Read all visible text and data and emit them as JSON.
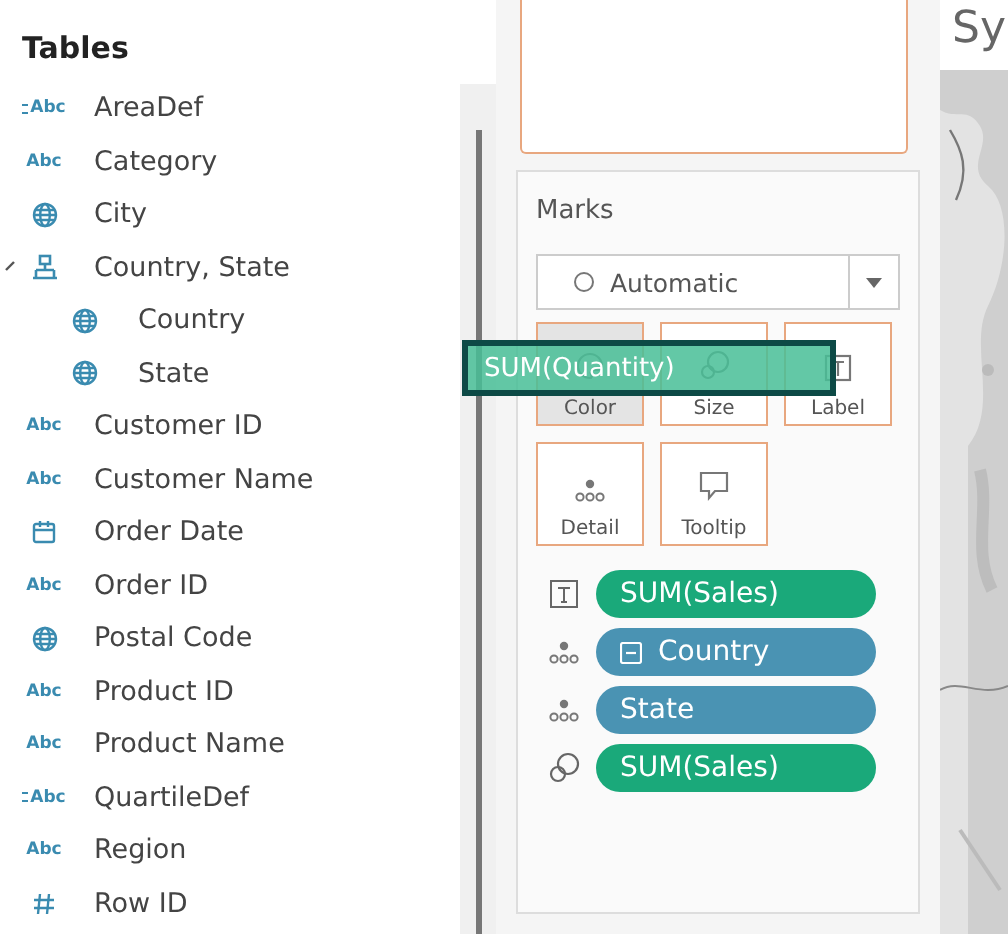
{
  "tables": {
    "title": "Tables",
    "fields": [
      {
        "name": "AreaDef",
        "kind": "calc-text",
        "type_label": "Abc"
      },
      {
        "name": "Category",
        "kind": "text",
        "type_label": "Abc"
      },
      {
        "name": "City",
        "kind": "geo"
      },
      {
        "name": "Country, State",
        "kind": "hierarchy",
        "expanded": true,
        "children": [
          {
            "name": "Country",
            "kind": "geo"
          },
          {
            "name": "State",
            "kind": "geo"
          }
        ]
      },
      {
        "name": "Customer ID",
        "kind": "text",
        "type_label": "Abc"
      },
      {
        "name": "Customer Name",
        "kind": "text",
        "type_label": "Abc"
      },
      {
        "name": "Order Date",
        "kind": "date"
      },
      {
        "name": "Order ID",
        "kind": "text",
        "type_label": "Abc"
      },
      {
        "name": "Postal Code",
        "kind": "geo"
      },
      {
        "name": "Product ID",
        "kind": "text",
        "type_label": "Abc"
      },
      {
        "name": "Product Name",
        "kind": "text",
        "type_label": "Abc"
      },
      {
        "name": "QuartileDef",
        "kind": "calc-text",
        "type_label": "Abc"
      },
      {
        "name": "Region",
        "kind": "text",
        "type_label": "Abc"
      },
      {
        "name": "Row ID",
        "kind": "number"
      }
    ]
  },
  "marks": {
    "title": "Marks",
    "mark_type": "Automatic",
    "buttons": [
      {
        "label": "Color",
        "kind": "color",
        "selected": true
      },
      {
        "label": "Size",
        "kind": "size",
        "selected": false
      },
      {
        "label": "Label",
        "kind": "label",
        "selected": false
      },
      {
        "label": "Detail",
        "kind": "detail",
        "selected": false
      },
      {
        "label": "Tooltip",
        "kind": "tooltip",
        "selected": false
      }
    ],
    "pills": [
      {
        "label": "SUM(Sales)",
        "kind": "label",
        "color": "#1aa97a",
        "collapsible": false
      },
      {
        "label": "Country",
        "kind": "detail",
        "color": "#4a93b3",
        "collapsible": true
      },
      {
        "label": "State",
        "kind": "detail",
        "color": "#4a93b3",
        "collapsible": false
      },
      {
        "label": "SUM(Sales)",
        "kind": "size",
        "color": "#1aa97a",
        "collapsible": false
      }
    ]
  },
  "drag_pill": {
    "label": "SUM(Quantity)"
  },
  "view": {
    "title": "Sy",
    "kind": "picture"
  }
}
